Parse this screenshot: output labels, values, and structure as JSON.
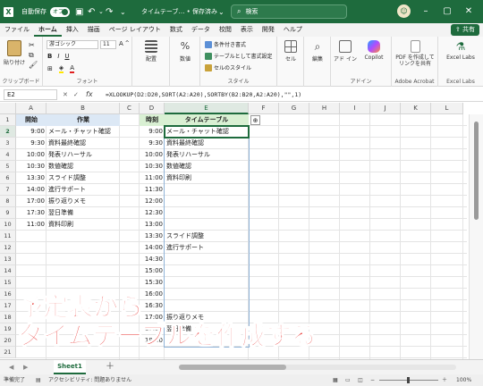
{
  "titlebar": {
    "autosave_label": "自動保存",
    "autosave_state": "オフ",
    "doc_title": "タイムテーブ… • 保存済み",
    "search_placeholder": "検索",
    "user_initial": "☺"
  },
  "menu": {
    "tabs": [
      "ファイル",
      "ホーム",
      "挿入",
      "描画",
      "ページ レイアウト",
      "数式",
      "データ",
      "校閲",
      "表示",
      "開発",
      "ヘルプ"
    ],
    "active": "ホーム",
    "share": "共有"
  },
  "ribbon": {
    "paste": "貼り付け",
    "clipboard": "クリップボード",
    "font_name": "游ゴシック",
    "font_size": "11",
    "font_group": "フォント",
    "align": "配置",
    "number": "数値",
    "cond_format": "条件付き書式",
    "table_format": "テーブルとして書式設定",
    "cell_style": "セルのスタイル",
    "style_group": "スタイル",
    "cells": "セル",
    "edit": "編集",
    "addin": "アド イン",
    "addin_group": "アドイン",
    "copilot": "Copilot",
    "pdf": "PDF を作成して リンクを共有",
    "acrobat_group": "Adobe Acrobat",
    "excel_labs": "Excel Labs",
    "excel_labs_group": "Excel Labs"
  },
  "formula_bar": {
    "name_box": "E2",
    "fx": "fx",
    "formula": "=XLOOKUP(D2:D20,SORT(A2:A20),SORTBY(B2:B20,A2:A20),\"\",1)"
  },
  "columns": [
    "A",
    "B",
    "C",
    "D",
    "E",
    "F",
    "G",
    "H",
    "I",
    "J",
    "K",
    "L"
  ],
  "rows": [
    "1",
    "2",
    "3",
    "4",
    "5",
    "6",
    "7",
    "8",
    "9",
    "10",
    "11",
    "12",
    "13",
    "14",
    "15",
    "16",
    "17",
    "18",
    "19",
    "20",
    "21"
  ],
  "schedule": {
    "header_time": "開始",
    "header_task": "作業",
    "times": [
      "9:00",
      "9:30",
      "10:00",
      "10:30",
      "13:30",
      "14:00",
      "17:00",
      "17:30",
      "11:00"
    ],
    "tasks": [
      "メール・チャット確認",
      "資料最終確認",
      "発表リハーサル",
      "数値確認",
      "スライド調整",
      "進行サポート",
      "振り返りメモ",
      "翌日準備",
      "資料印刷"
    ]
  },
  "timetable": {
    "header_time": "時刻",
    "header_table": "タイムテーブル",
    "times": [
      "9:00",
      "9:30",
      "10:00",
      "10:30",
      "11:00",
      "11:30",
      "12:00",
      "12:30",
      "13:00",
      "13:30",
      "14:00",
      "14:30",
      "15:00",
      "15:30",
      "16:00",
      "16:30",
      "17:00",
      "17:30",
      "18:00"
    ],
    "entries": [
      "メール・チャット確認",
      "資料最終確認",
      "発表リハーサル",
      "数値確認",
      "資料印刷",
      "",
      "",
      "",
      "",
      "スライド調整",
      "進行サポート",
      "",
      "",
      "",
      "",
      "",
      "振り返りメモ",
      "翌日準備",
      ""
    ]
  },
  "sheet_tab": "Sheet1",
  "status": {
    "ready": "準備完了",
    "accessibility": "アクセシビリティ: 問題ありません",
    "zoom": "100%"
  },
  "overlay": {
    "line1": "予定表から",
    "line2": "タイムテーブルを作成する"
  },
  "colors": {
    "excel_green": "#1e6b3d",
    "header_blue": "#dce8f5",
    "header_green": "#d9f0d3",
    "overlay_red": "#e8312e"
  }
}
